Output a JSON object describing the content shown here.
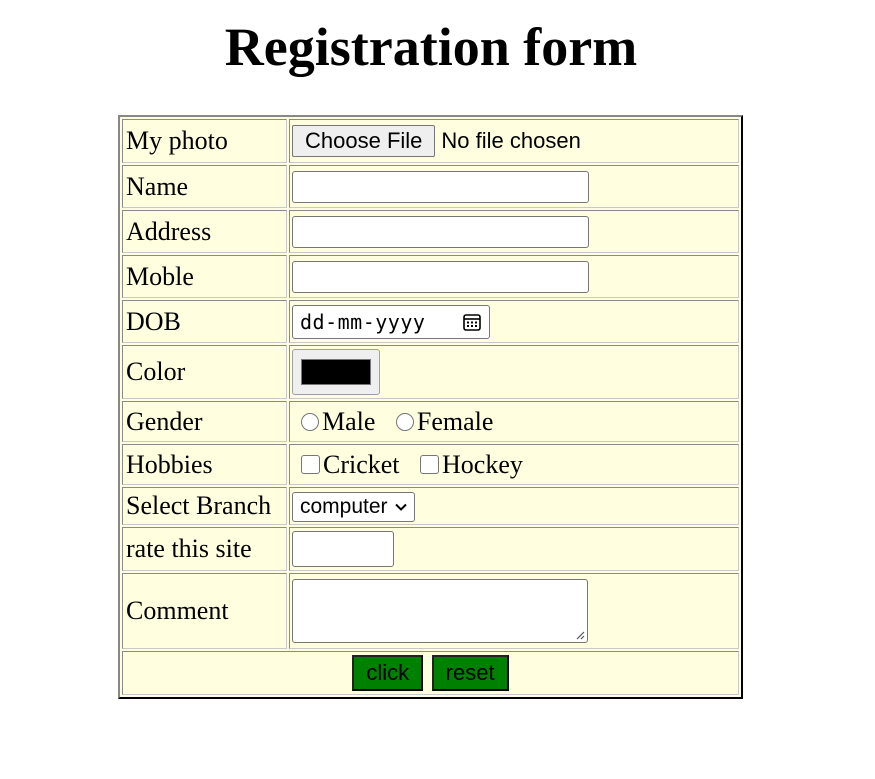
{
  "page": {
    "title": "Registration form"
  },
  "form": {
    "photo": {
      "label": "My photo",
      "button_label": "Choose File",
      "status": "No file chosen"
    },
    "name": {
      "label": "Name",
      "value": ""
    },
    "address": {
      "label": "Address",
      "value": ""
    },
    "mobile": {
      "label": "Moble",
      "value": ""
    },
    "dob": {
      "label": "DOB",
      "placeholder": "dd-mm-yyyy",
      "icon": "calendar-icon"
    },
    "color": {
      "label": "Color",
      "value": "#000000"
    },
    "gender": {
      "label": "Gender",
      "options": [
        {
          "label": "Male",
          "checked": false
        },
        {
          "label": "Female",
          "checked": false
        }
      ]
    },
    "hobbies": {
      "label": "Hobbies",
      "options": [
        {
          "label": "Cricket",
          "checked": false
        },
        {
          "label": "Hockey",
          "checked": false
        }
      ]
    },
    "branch": {
      "label": "Select Branch",
      "selected": "computer",
      "icon": "chevron-down-icon"
    },
    "rate": {
      "label": "rate this site",
      "value": ""
    },
    "comment": {
      "label": "Comment",
      "value": ""
    },
    "actions": {
      "submit_label": "click",
      "reset_label": "reset"
    }
  },
  "colors": {
    "table_background": "#ffffe0",
    "button_background": "#008000"
  }
}
